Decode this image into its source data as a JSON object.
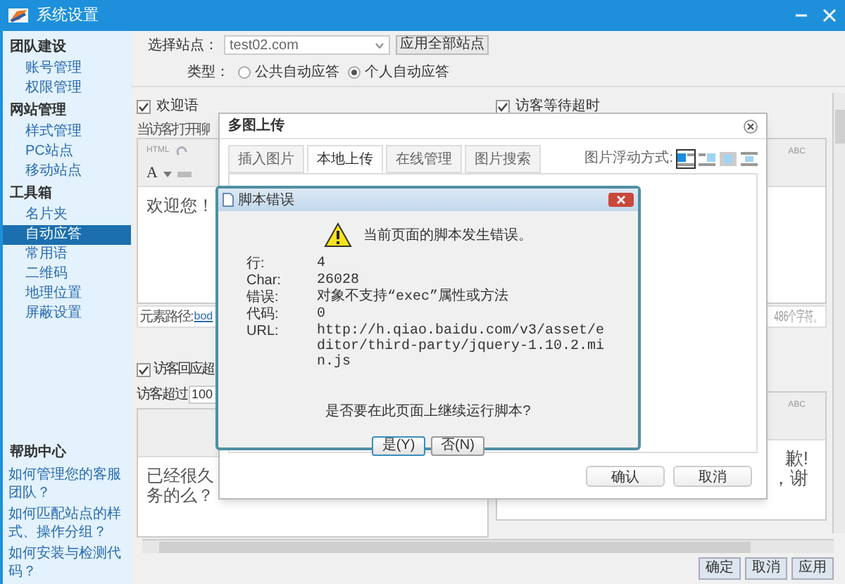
{
  "window": {
    "title": "系统设置"
  },
  "sidebar": {
    "groups": [
      {
        "title": "团队建设",
        "items": [
          {
            "label": "账号管理",
            "selected": false
          },
          {
            "label": "权限管理",
            "selected": false
          }
        ]
      },
      {
        "title": "网站管理",
        "items": [
          {
            "label": "样式管理",
            "selected": false
          },
          {
            "label": "PC站点",
            "selected": false
          },
          {
            "label": "移动站点",
            "selected": false
          }
        ]
      },
      {
        "title": "工具箱",
        "items": [
          {
            "label": "名片夹",
            "selected": false
          },
          {
            "label": "自动应答",
            "selected": true
          },
          {
            "label": "常用语",
            "selected": false
          },
          {
            "label": "二维码",
            "selected": false
          },
          {
            "label": "地理位置",
            "selected": false
          },
          {
            "label": "屏蔽设置",
            "selected": false
          }
        ]
      }
    ],
    "help": {
      "title": "帮助中心",
      "links": [
        "如何管理您的客服团队？",
        "如何匹配站点的样式、操作分组？",
        "如何安装与检测代码？"
      ]
    }
  },
  "site_bar": {
    "label": "选择站点：",
    "value": "test02.com",
    "apply_all": "应用全部站点",
    "type_label": "类型：",
    "types": [
      {
        "label": "公共自动应答",
        "selected": false
      },
      {
        "label": "个人自动应答",
        "selected": true
      }
    ]
  },
  "left_panel": {
    "welcome": {
      "label": "欢迎语",
      "checked": true
    },
    "hint": "当访客打开聊",
    "toolbar": {
      "html": "HTML",
      "font": "A"
    },
    "editor_text": "欢迎您！",
    "path_label": "元素路径:",
    "path_link": "bod",
    "reply": {
      "label": "访客回应超",
      "checked": true
    },
    "exceed_label": "访客超过",
    "exceed_value": "100",
    "editor2_lines": [
      "已经很久",
      "务的么？"
    ]
  },
  "right_panel": {
    "wait": {
      "label": "访客等待超时",
      "checked": true
    },
    "toolbar_hint": "ABC",
    "count": "486个字符。",
    "toolbar2_hint": "ABC",
    "editor2_lines": [
      "歉!",
      "，谢"
    ]
  },
  "upload_dialog": {
    "title": "多图上传",
    "tabs": [
      {
        "label": "插入图片",
        "selected": false
      },
      {
        "label": "本地上传",
        "selected": true
      },
      {
        "label": "在线管理",
        "selected": false
      },
      {
        "label": "图片搜索",
        "selected": false
      }
    ],
    "float_label": "图片浮动方式:",
    "float_modes": [
      {
        "kind": "left",
        "selected": true
      },
      {
        "kind": "right",
        "selected": false
      },
      {
        "kind": "none",
        "selected": false
      },
      {
        "kind": "center",
        "selected": false
      }
    ],
    "buttons": [
      "确认",
      "取消"
    ]
  },
  "error_dialog": {
    "title": "脚本错误",
    "message": "当前页面的脚本发生错误。",
    "details": [
      {
        "label": "行:",
        "value": "4"
      },
      {
        "label": "Char:",
        "value": "26028"
      },
      {
        "label": "错误:",
        "value": "对象不支持“exec”属性或方法"
      },
      {
        "label": "代码:",
        "value": "0"
      },
      {
        "label": "URL:",
        "value": "http://h.qiao.baidu.com/v3/asset/editor/third-party/jquery-1.10.2.min.js"
      }
    ],
    "question": "是否要在此页面上继续运行脚本?",
    "buttons": [
      "是(Y)",
      "否(N)"
    ]
  },
  "footer_buttons": [
    "确定",
    "取消",
    "应用"
  ]
}
